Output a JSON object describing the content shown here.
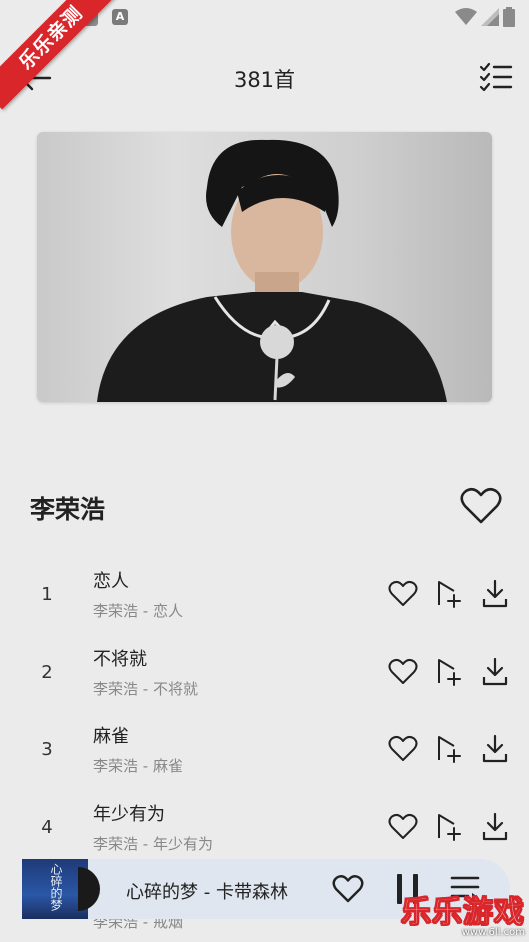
{
  "header": {
    "title": "381首",
    "back_icon": "arrow-left-icon",
    "list_icon": "checklist-icon"
  },
  "watermark": {
    "ribbon": "乐乐亲测",
    "brand": "乐乐游戏",
    "url": "www.6ll.com"
  },
  "artist": {
    "name": "李荣浩"
  },
  "songs": [
    {
      "index": "1",
      "title": "恋人",
      "subtitle": "李荣浩 - 恋人"
    },
    {
      "index": "2",
      "title": "不将就",
      "subtitle": "李荣浩 - 不将就"
    },
    {
      "index": "3",
      "title": "麻雀",
      "subtitle": "李荣浩 - 麻雀"
    },
    {
      "index": "4",
      "title": "年少有为",
      "subtitle": "李荣浩 - 年少有为"
    }
  ],
  "peek_subtitle": "李荣浩 - 戒烟",
  "player": {
    "now_playing": "心碎的梦 - 卡带森林",
    "art_text": "心碎的梦"
  },
  "colors": {
    "background": "#ebebeb",
    "player_bg": "#dfe6ef",
    "ribbon": "#d8262a"
  }
}
